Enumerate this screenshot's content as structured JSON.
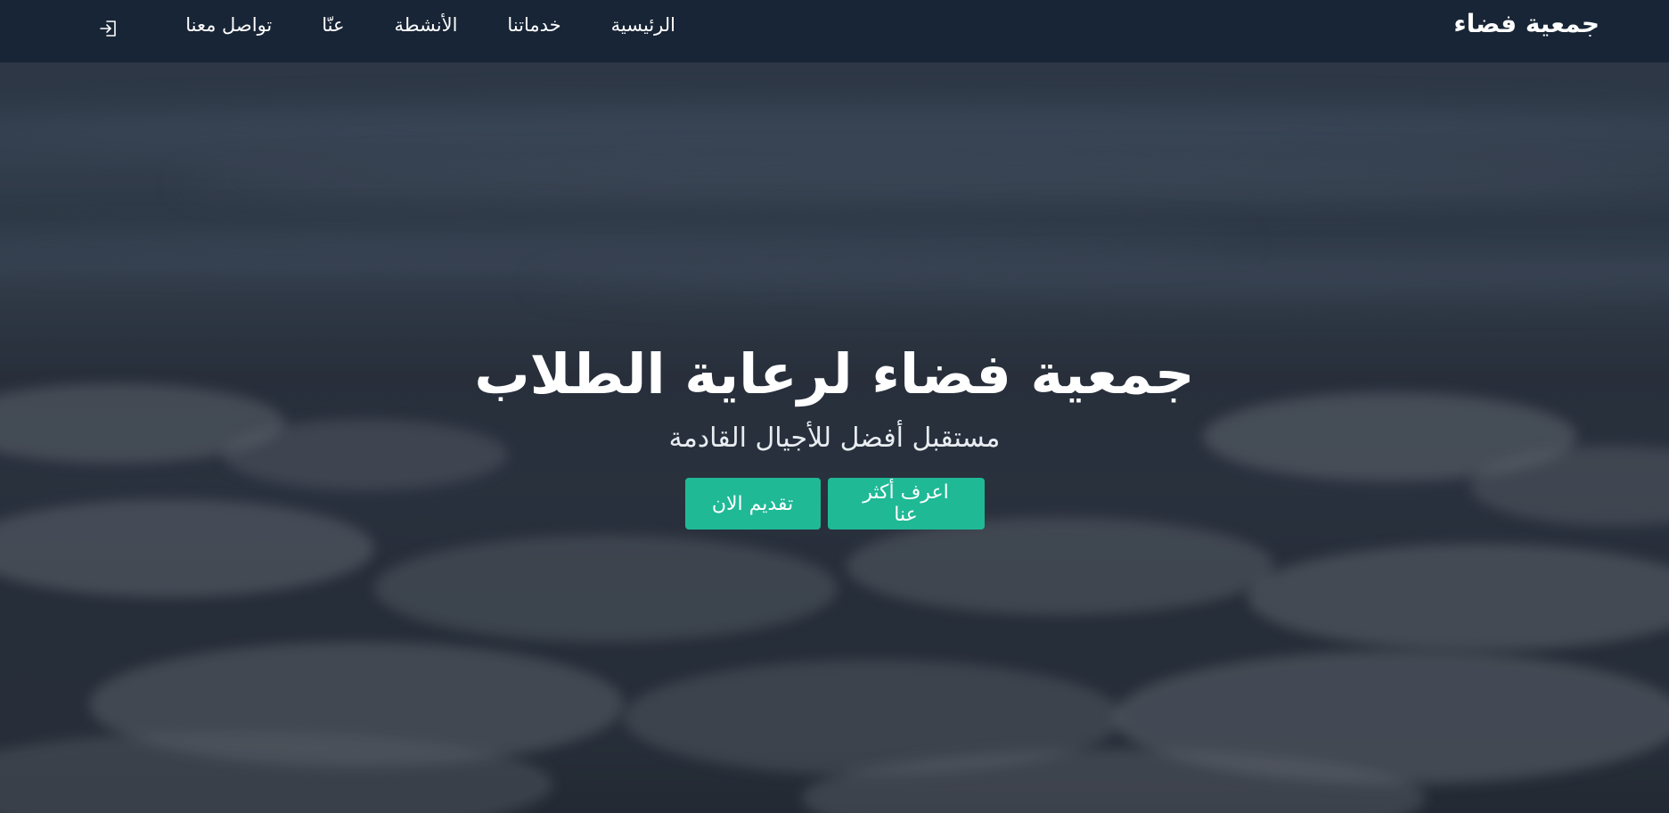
{
  "brand": {
    "name": "جمعية فضاء"
  },
  "nav": {
    "items": [
      {
        "label": "الرئيسية"
      },
      {
        "label": "خدماتنا"
      },
      {
        "label": "الأنشطة"
      },
      {
        "label": "عنّا"
      },
      {
        "label": "تواصل معنا"
      }
    ],
    "login_icon": "login-icon"
  },
  "hero": {
    "title": "جمعية فضاء لرعاية الطلاب",
    "subtitle": "مستقبل أفضل للأجيال القادمة",
    "learn_more_label": "اعرف أكثر عنا",
    "apply_label": "تقديم الان"
  },
  "colors": {
    "navbar": "#162334",
    "accent": "#1fb996",
    "text": "#ffffff"
  }
}
